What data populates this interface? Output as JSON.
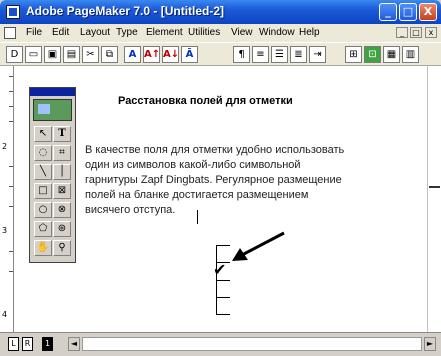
{
  "window": {
    "title": "Adobe PageMaker 7.0 - [Untitled-2]",
    "minimize_label": "_",
    "maximize_label": "□",
    "close_label": "X"
  },
  "menu": {
    "items": [
      "File",
      "Edit",
      "Layout",
      "Type",
      "Element",
      "Utilities",
      "View",
      "Window",
      "Help"
    ],
    "mdi_min": "_",
    "mdi_max": "□",
    "mdi_close": "x"
  },
  "toolbar": {
    "buttons": [
      {
        "icon": "new-document-icon",
        "glyph": "D"
      },
      {
        "icon": "open-icon",
        "glyph": "▭"
      },
      {
        "icon": "save-icon",
        "glyph": "▣"
      },
      {
        "icon": "print-icon",
        "glyph": "▤"
      },
      {
        "icon": "cut-icon",
        "glyph": "✂"
      },
      {
        "icon": "copy-icon",
        "glyph": "⧉"
      },
      {
        "icon": "paste-icon",
        "glyph": "▥"
      },
      {
        "icon": "character-icon",
        "glyph": "A"
      },
      {
        "icon": "font-size-up-icon",
        "glyph": "A↑"
      },
      {
        "icon": "font-size-down-icon",
        "glyph": "A↓"
      },
      {
        "icon": "kerning-icon",
        "glyph": "Ā"
      },
      {
        "icon": "pilcrow-icon",
        "glyph": "¶"
      },
      {
        "icon": "align-left-icon",
        "glyph": "≡"
      },
      {
        "icon": "bullets-icon",
        "glyph": "☰"
      },
      {
        "icon": "indent-icon",
        "glyph": "≣"
      },
      {
        "icon": "tabs-icon",
        "glyph": "⇥"
      },
      {
        "icon": "frame-icon",
        "glyph": "⊞"
      },
      {
        "icon": "place-icon",
        "glyph": "⊡"
      },
      {
        "icon": "image-icon",
        "glyph": "▦"
      }
    ]
  },
  "ruler": {
    "marks": [
      "2",
      "3",
      "4"
    ]
  },
  "document": {
    "heading": "Расстановка полей для отметки",
    "paragraph_lines": [
      "В качестве поля для отметки удобно использовать",
      "один из символов какой-либо символьной",
      "гарнитуры Zapf Dingbats. Регулярное размещение",
      "полей на бланке достигается размещением",
      "висячего отступа."
    ],
    "checkmark": "✔"
  },
  "status": {
    "pages": [
      "L",
      "R",
      "1"
    ],
    "active_page": "1",
    "scroll_left": "◄",
    "scroll_right": "►"
  }
}
